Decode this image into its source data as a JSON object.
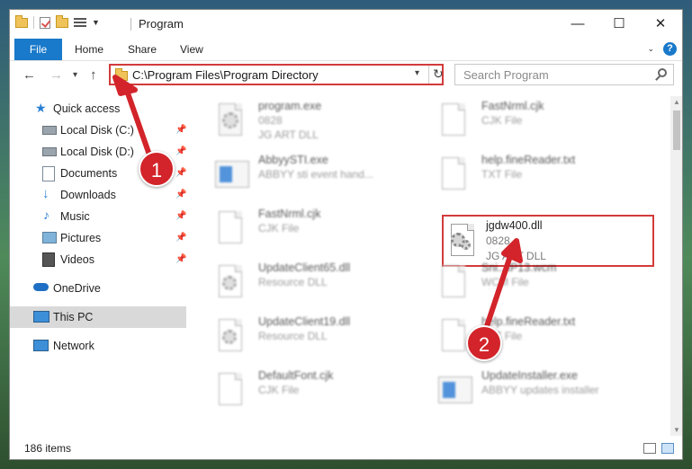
{
  "window": {
    "title": "Program",
    "controls": {
      "minimize": "—",
      "maximize": "☐",
      "close": "✕"
    }
  },
  "ribbon": {
    "tabs": [
      "File",
      "Home",
      "Share",
      "View"
    ],
    "help": "?"
  },
  "navigation": {
    "back": "←",
    "forward": "→",
    "recent": "▾",
    "up": "↑",
    "address": "C:\\Program Files\\Program Directory",
    "refresh": "↻",
    "search_placeholder": "Search Program"
  },
  "sidebar": {
    "items": [
      {
        "label": "Quick access",
        "icon": "star-icon",
        "pinned": false
      },
      {
        "label": "Local Disk (C:)",
        "icon": "drive-icon",
        "pinned": true
      },
      {
        "label": "Local Disk (D:)",
        "icon": "drive-icon",
        "pinned": true
      },
      {
        "label": "Documents",
        "icon": "documents-icon",
        "pinned": true
      },
      {
        "label": "Downloads",
        "icon": "download-icon",
        "pinned": true
      },
      {
        "label": "Music",
        "icon": "music-icon",
        "pinned": true
      },
      {
        "label": "Pictures",
        "icon": "pictures-icon",
        "pinned": true
      },
      {
        "label": "Videos",
        "icon": "videos-icon",
        "pinned": true
      },
      {
        "label": "OneDrive",
        "icon": "cloud-icon",
        "pinned": false
      },
      {
        "label": "This PC",
        "icon": "pc-icon",
        "pinned": false,
        "selected": true
      },
      {
        "label": "Network",
        "icon": "network-icon",
        "pinned": false
      }
    ]
  },
  "files": [
    {
      "name": "program.exe",
      "line2": "0828",
      "line3": "JG ART DLL",
      "icon": "exe-icon"
    },
    {
      "name": "FastNrml.cjk",
      "line2": "CJK File",
      "line3": "",
      "icon": "document-icon"
    },
    {
      "name": "AbbyySTI.exe",
      "line2": "ABBYY sti event hand...",
      "line3": "",
      "icon": "app-icon"
    },
    {
      "name": "help.fineReader.txt",
      "line2": "TXT File",
      "line3": "",
      "icon": "document-icon"
    },
    {
      "name": "FastNrml.cjk",
      "line2": "CJK File",
      "line3": "",
      "icon": "document-icon"
    },
    {
      "name": "jgdw400.dll",
      "line2": "0828",
      "line3": "JG ART DLL",
      "icon": "dll-gear-icon",
      "highlighted": true
    },
    {
      "name": "UpdateClient65.dll",
      "line2": "Resource DLL",
      "line3": "",
      "icon": "dll-gear-icon"
    },
    {
      "name": "Sni...tP13.wcm",
      "line2": "WCM File",
      "line3": "",
      "icon": "document-icon"
    },
    {
      "name": "UpdateClient19.dll",
      "line2": "Resource DLL",
      "line3": "",
      "icon": "dll-gear-icon"
    },
    {
      "name": "help.fineReader.txt",
      "line2": "TXT File",
      "line3": "",
      "icon": "document-icon"
    },
    {
      "name": "DefaultFont.cjk",
      "line2": "CJK File",
      "line3": "",
      "icon": "document-icon"
    },
    {
      "name": "UpdateInstaller.exe",
      "line2": "ABBYY updates installer",
      "line3": "",
      "icon": "app-icon"
    }
  ],
  "status": {
    "items": "186 items"
  },
  "annotations": [
    {
      "number": "1",
      "target": "address-bar"
    },
    {
      "number": "2",
      "target": "jgdw400.dll"
    }
  ],
  "colors": {
    "accent": "#1979ca",
    "highlight": "#d33b3b",
    "marker": "#d2242a"
  }
}
